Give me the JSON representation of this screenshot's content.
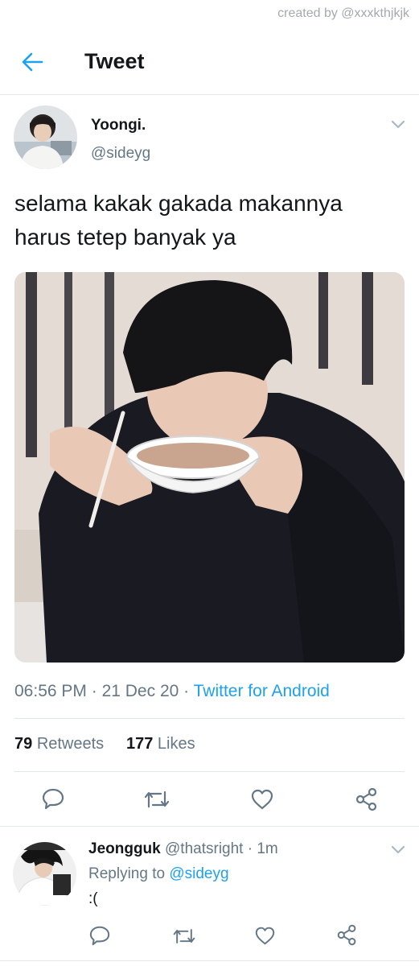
{
  "watermark": "created by @xxxkthjkjk",
  "header": {
    "title": "Tweet",
    "back_icon": "arrow-left-icon"
  },
  "tweet": {
    "author_name": "Yoongi.",
    "author_handle": "@sideyg",
    "text": "selama kakak gakada makannya harus tetep banyak ya",
    "time": "06:56 PM",
    "date": "21 Dec 20",
    "source": "Twitter for Android",
    "retweets_count": "79",
    "retweets_label": "Retweets",
    "likes_count": "177",
    "likes_label": "Likes"
  },
  "reply": {
    "author_name": "Jeongguk",
    "author_handle": "@thatsright",
    "time": "1m",
    "replying_prefix": "Replying to",
    "replying_to": "@sideyg",
    "text": ":("
  },
  "colors": {
    "accent": "#1da1f2",
    "secondary_text": "#657786",
    "divider": "#e1e8ed"
  }
}
